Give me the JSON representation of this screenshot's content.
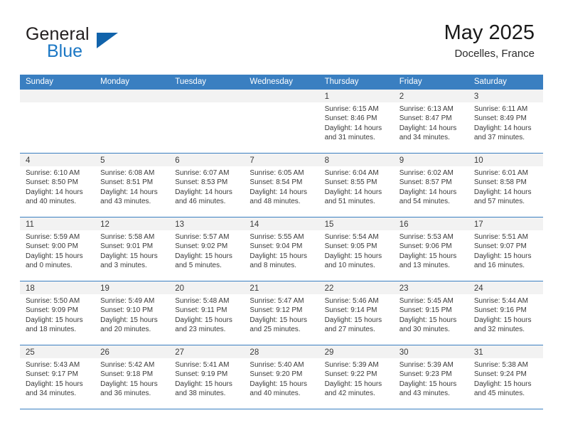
{
  "brand": {
    "name_top": "General",
    "name_bottom": "Blue",
    "logo_icon": "triangle-logo-icon",
    "color_dark": "#231f20",
    "color_blue": "#1b77c4",
    "triangle_color": "#1163ab"
  },
  "header": {
    "title": "May 2025",
    "subtitle": "Docelles, France"
  },
  "theme": {
    "header_row_bg": "#3a7fc1",
    "day_number_bg": "#f2f2f2",
    "grid_line": "#3a7fc1",
    "text": "#3a3a3a"
  },
  "weekdays": [
    "Sunday",
    "Monday",
    "Tuesday",
    "Wednesday",
    "Thursday",
    "Friday",
    "Saturday"
  ],
  "weeks": [
    [
      {
        "day": "",
        "sunrise": "",
        "sunset": "",
        "daylight_line1": "",
        "daylight_line2": ""
      },
      {
        "day": "",
        "sunrise": "",
        "sunset": "",
        "daylight_line1": "",
        "daylight_line2": ""
      },
      {
        "day": "",
        "sunrise": "",
        "sunset": "",
        "daylight_line1": "",
        "daylight_line2": ""
      },
      {
        "day": "",
        "sunrise": "",
        "sunset": "",
        "daylight_line1": "",
        "daylight_line2": ""
      },
      {
        "day": "1",
        "sunrise": "Sunrise: 6:15 AM",
        "sunset": "Sunset: 8:46 PM",
        "daylight_line1": "Daylight: 14 hours",
        "daylight_line2": "and 31 minutes."
      },
      {
        "day": "2",
        "sunrise": "Sunrise: 6:13 AM",
        "sunset": "Sunset: 8:47 PM",
        "daylight_line1": "Daylight: 14 hours",
        "daylight_line2": "and 34 minutes."
      },
      {
        "day": "3",
        "sunrise": "Sunrise: 6:11 AM",
        "sunset": "Sunset: 8:49 PM",
        "daylight_line1": "Daylight: 14 hours",
        "daylight_line2": "and 37 minutes."
      }
    ],
    [
      {
        "day": "4",
        "sunrise": "Sunrise: 6:10 AM",
        "sunset": "Sunset: 8:50 PM",
        "daylight_line1": "Daylight: 14 hours",
        "daylight_line2": "and 40 minutes."
      },
      {
        "day": "5",
        "sunrise": "Sunrise: 6:08 AM",
        "sunset": "Sunset: 8:51 PM",
        "daylight_line1": "Daylight: 14 hours",
        "daylight_line2": "and 43 minutes."
      },
      {
        "day": "6",
        "sunrise": "Sunrise: 6:07 AM",
        "sunset": "Sunset: 8:53 PM",
        "daylight_line1": "Daylight: 14 hours",
        "daylight_line2": "and 46 minutes."
      },
      {
        "day": "7",
        "sunrise": "Sunrise: 6:05 AM",
        "sunset": "Sunset: 8:54 PM",
        "daylight_line1": "Daylight: 14 hours",
        "daylight_line2": "and 48 minutes."
      },
      {
        "day": "8",
        "sunrise": "Sunrise: 6:04 AM",
        "sunset": "Sunset: 8:55 PM",
        "daylight_line1": "Daylight: 14 hours",
        "daylight_line2": "and 51 minutes."
      },
      {
        "day": "9",
        "sunrise": "Sunrise: 6:02 AM",
        "sunset": "Sunset: 8:57 PM",
        "daylight_line1": "Daylight: 14 hours",
        "daylight_line2": "and 54 minutes."
      },
      {
        "day": "10",
        "sunrise": "Sunrise: 6:01 AM",
        "sunset": "Sunset: 8:58 PM",
        "daylight_line1": "Daylight: 14 hours",
        "daylight_line2": "and 57 minutes."
      }
    ],
    [
      {
        "day": "11",
        "sunrise": "Sunrise: 5:59 AM",
        "sunset": "Sunset: 9:00 PM",
        "daylight_line1": "Daylight: 15 hours",
        "daylight_line2": "and 0 minutes."
      },
      {
        "day": "12",
        "sunrise": "Sunrise: 5:58 AM",
        "sunset": "Sunset: 9:01 PM",
        "daylight_line1": "Daylight: 15 hours",
        "daylight_line2": "and 3 minutes."
      },
      {
        "day": "13",
        "sunrise": "Sunrise: 5:57 AM",
        "sunset": "Sunset: 9:02 PM",
        "daylight_line1": "Daylight: 15 hours",
        "daylight_line2": "and 5 minutes."
      },
      {
        "day": "14",
        "sunrise": "Sunrise: 5:55 AM",
        "sunset": "Sunset: 9:04 PM",
        "daylight_line1": "Daylight: 15 hours",
        "daylight_line2": "and 8 minutes."
      },
      {
        "day": "15",
        "sunrise": "Sunrise: 5:54 AM",
        "sunset": "Sunset: 9:05 PM",
        "daylight_line1": "Daylight: 15 hours",
        "daylight_line2": "and 10 minutes."
      },
      {
        "day": "16",
        "sunrise": "Sunrise: 5:53 AM",
        "sunset": "Sunset: 9:06 PM",
        "daylight_line1": "Daylight: 15 hours",
        "daylight_line2": "and 13 minutes."
      },
      {
        "day": "17",
        "sunrise": "Sunrise: 5:51 AM",
        "sunset": "Sunset: 9:07 PM",
        "daylight_line1": "Daylight: 15 hours",
        "daylight_line2": "and 16 minutes."
      }
    ],
    [
      {
        "day": "18",
        "sunrise": "Sunrise: 5:50 AM",
        "sunset": "Sunset: 9:09 PM",
        "daylight_line1": "Daylight: 15 hours",
        "daylight_line2": "and 18 minutes."
      },
      {
        "day": "19",
        "sunrise": "Sunrise: 5:49 AM",
        "sunset": "Sunset: 9:10 PM",
        "daylight_line1": "Daylight: 15 hours",
        "daylight_line2": "and 20 minutes."
      },
      {
        "day": "20",
        "sunrise": "Sunrise: 5:48 AM",
        "sunset": "Sunset: 9:11 PM",
        "daylight_line1": "Daylight: 15 hours",
        "daylight_line2": "and 23 minutes."
      },
      {
        "day": "21",
        "sunrise": "Sunrise: 5:47 AM",
        "sunset": "Sunset: 9:12 PM",
        "daylight_line1": "Daylight: 15 hours",
        "daylight_line2": "and 25 minutes."
      },
      {
        "day": "22",
        "sunrise": "Sunrise: 5:46 AM",
        "sunset": "Sunset: 9:14 PM",
        "daylight_line1": "Daylight: 15 hours",
        "daylight_line2": "and 27 minutes."
      },
      {
        "day": "23",
        "sunrise": "Sunrise: 5:45 AM",
        "sunset": "Sunset: 9:15 PM",
        "daylight_line1": "Daylight: 15 hours",
        "daylight_line2": "and 30 minutes."
      },
      {
        "day": "24",
        "sunrise": "Sunrise: 5:44 AM",
        "sunset": "Sunset: 9:16 PM",
        "daylight_line1": "Daylight: 15 hours",
        "daylight_line2": "and 32 minutes."
      }
    ],
    [
      {
        "day": "25",
        "sunrise": "Sunrise: 5:43 AM",
        "sunset": "Sunset: 9:17 PM",
        "daylight_line1": "Daylight: 15 hours",
        "daylight_line2": "and 34 minutes."
      },
      {
        "day": "26",
        "sunrise": "Sunrise: 5:42 AM",
        "sunset": "Sunset: 9:18 PM",
        "daylight_line1": "Daylight: 15 hours",
        "daylight_line2": "and 36 minutes."
      },
      {
        "day": "27",
        "sunrise": "Sunrise: 5:41 AM",
        "sunset": "Sunset: 9:19 PM",
        "daylight_line1": "Daylight: 15 hours",
        "daylight_line2": "and 38 minutes."
      },
      {
        "day": "28",
        "sunrise": "Sunrise: 5:40 AM",
        "sunset": "Sunset: 9:20 PM",
        "daylight_line1": "Daylight: 15 hours",
        "daylight_line2": "and 40 minutes."
      },
      {
        "day": "29",
        "sunrise": "Sunrise: 5:39 AM",
        "sunset": "Sunset: 9:22 PM",
        "daylight_line1": "Daylight: 15 hours",
        "daylight_line2": "and 42 minutes."
      },
      {
        "day": "30",
        "sunrise": "Sunrise: 5:39 AM",
        "sunset": "Sunset: 9:23 PM",
        "daylight_line1": "Daylight: 15 hours",
        "daylight_line2": "and 43 minutes."
      },
      {
        "day": "31",
        "sunrise": "Sunrise: 5:38 AM",
        "sunset": "Sunset: 9:24 PM",
        "daylight_line1": "Daylight: 15 hours",
        "daylight_line2": "and 45 minutes."
      }
    ]
  ]
}
